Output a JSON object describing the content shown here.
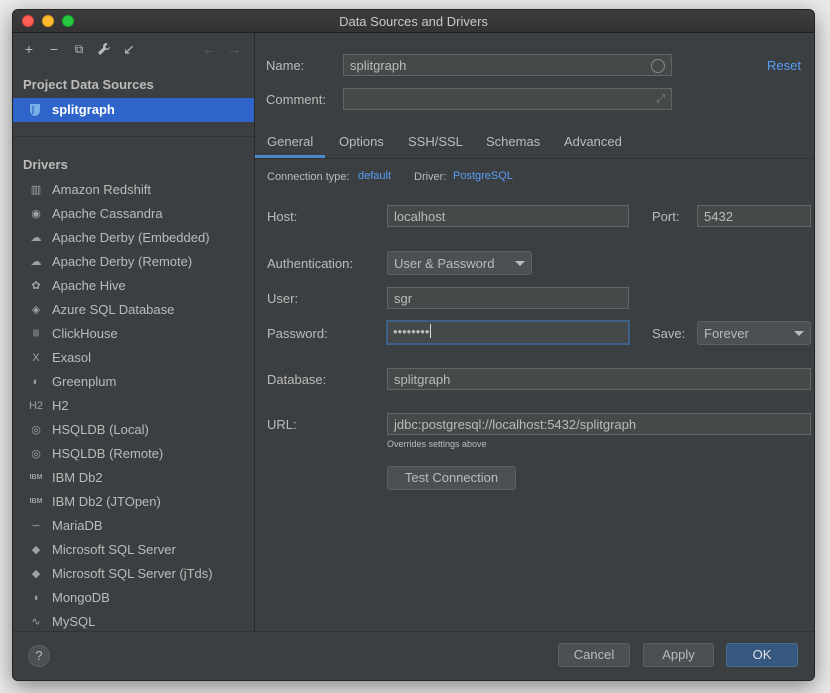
{
  "window": {
    "title": "Data Sources and Drivers"
  },
  "toolbar": {
    "add_icon": "+",
    "remove_icon": "−",
    "copy_icon": "⧉",
    "wrench_icon": "🔧",
    "goto_icon": "↙",
    "back_icon": "←",
    "forward_icon": "→"
  },
  "sidebar": {
    "project_title": "Project Data Sources",
    "selected_datasource": "splitgraph",
    "drivers_title": "Drivers",
    "drivers": [
      {
        "label": "Amazon Redshift",
        "icon": "▥"
      },
      {
        "label": "Apache Cassandra",
        "icon": "◉"
      },
      {
        "label": "Apache Derby (Embedded)",
        "icon": "☁"
      },
      {
        "label": "Apache Derby (Remote)",
        "icon": "☁"
      },
      {
        "label": "Apache Hive",
        "icon": "✿"
      },
      {
        "label": "Azure SQL Database",
        "icon": "◈"
      },
      {
        "label": "ClickHouse",
        "icon": "|||"
      },
      {
        "label": "Exasol",
        "icon": "X"
      },
      {
        "label": "Greenplum",
        "icon": "◐"
      },
      {
        "label": "H2",
        "icon": "H2"
      },
      {
        "label": "HSQLDB (Local)",
        "icon": "◎"
      },
      {
        "label": "HSQLDB (Remote)",
        "icon": "◎"
      },
      {
        "label": "IBM Db2",
        "icon": "IBM"
      },
      {
        "label": "IBM Db2 (JTOpen)",
        "icon": "IBM"
      },
      {
        "label": "MariaDB",
        "icon": "∽"
      },
      {
        "label": "Microsoft SQL Server",
        "icon": "◆"
      },
      {
        "label": "Microsoft SQL Server (jTds)",
        "icon": "◆"
      },
      {
        "label": "MongoDB",
        "icon": "◖"
      },
      {
        "label": "MySQL",
        "icon": "∿"
      }
    ]
  },
  "form": {
    "name_label": "Name:",
    "name_value": "splitgraph",
    "reset_label": "Reset",
    "comment_label": "Comment:",
    "comment_value": "",
    "tabs": [
      "General",
      "Options",
      "SSH/SSL",
      "Schemas",
      "Advanced"
    ],
    "active_tab": "General",
    "connection_type_label": "Connection type:",
    "connection_type_value": "default",
    "driver_label": "Driver:",
    "driver_value": "PostgreSQL",
    "host_label": "Host:",
    "host_value": "localhost",
    "port_label": "Port:",
    "port_value": "5432",
    "auth_label": "Authentication:",
    "auth_value": "User & Password",
    "user_label": "User:",
    "user_value": "sgr",
    "password_label": "Password:",
    "password_value": "••••••••",
    "save_label": "Save:",
    "save_value": "Forever",
    "database_label": "Database:",
    "database_value": "splitgraph",
    "url_label": "URL:",
    "url_value": "jdbc:postgresql://localhost:5432/splitgraph",
    "url_hint": "Overrides settings above",
    "test_connection_label": "Test Connection"
  },
  "footer": {
    "help_label": "?",
    "cancel_label": "Cancel",
    "apply_label": "Apply",
    "ok_label": "OK"
  },
  "colors": {
    "background": "#3c3f41",
    "selection": "#2f65ca",
    "link": "#589df6",
    "primary_button": "#365880",
    "tab_underline": "#4a88c7"
  }
}
